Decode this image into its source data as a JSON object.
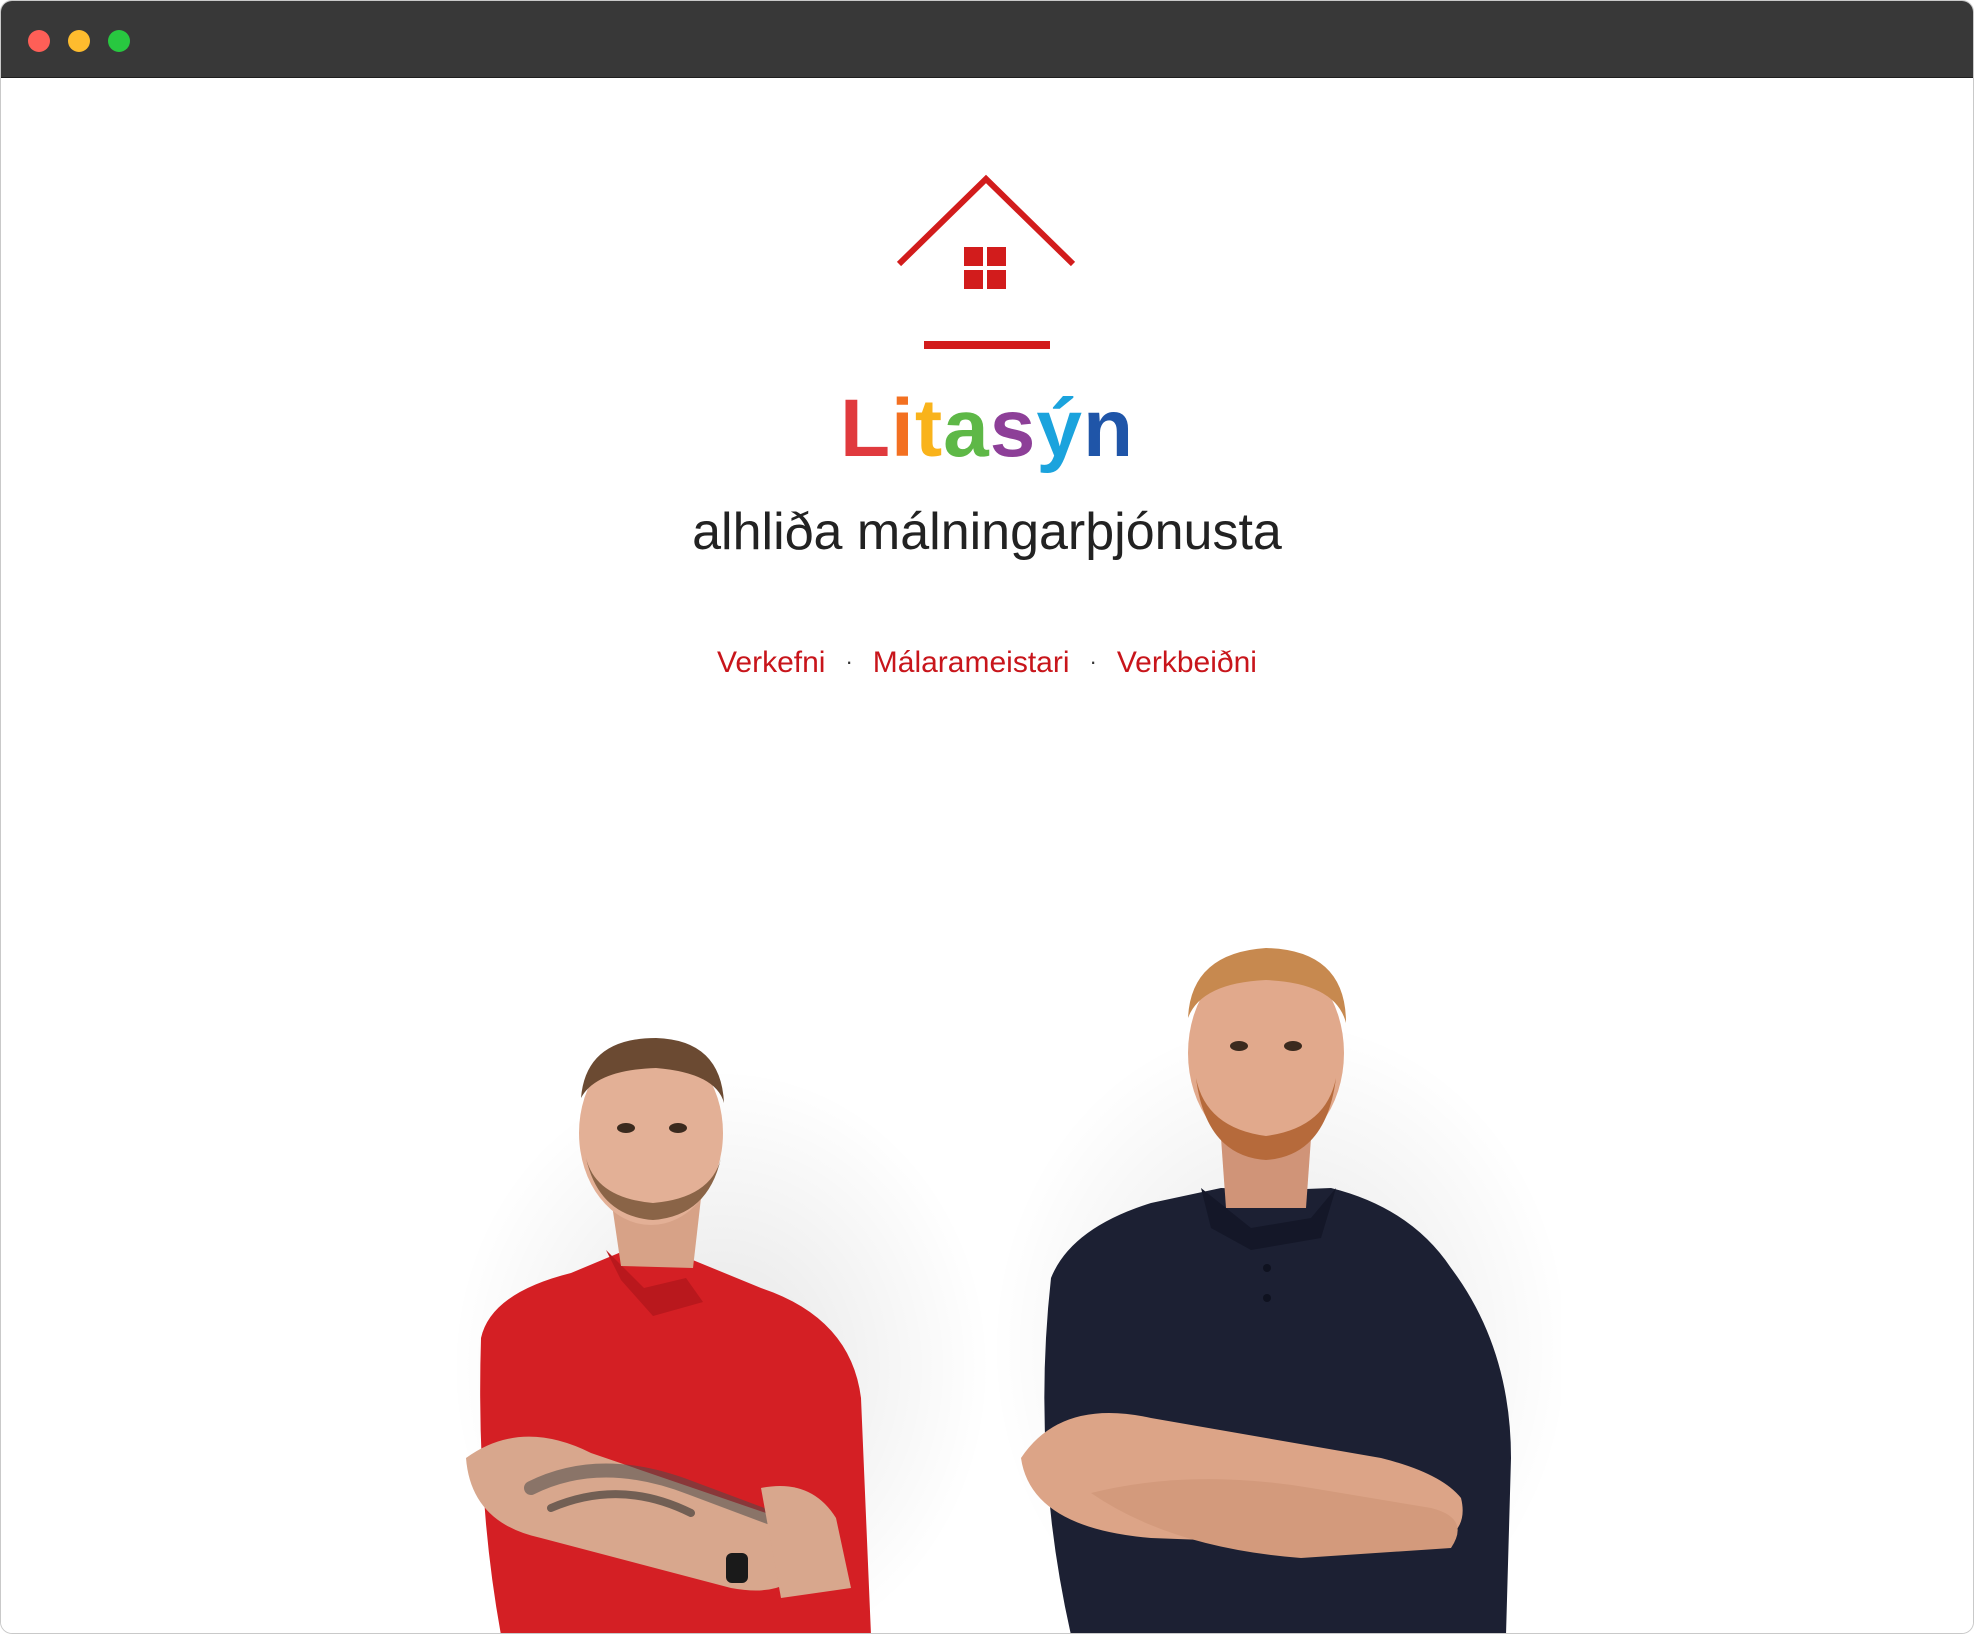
{
  "window": {
    "controls": [
      "close",
      "minimize",
      "maximize"
    ]
  },
  "brand": {
    "logo_icon": "house-icon",
    "letters": [
      {
        "char": "L",
        "color": "#e03a3e"
      },
      {
        "char": "i",
        "color": "#f37021"
      },
      {
        "char": "t",
        "color": "#f9b31b"
      },
      {
        "char": "a",
        "color": "#5eb847"
      },
      {
        "char": "s",
        "color": "#8d3f98"
      },
      {
        "char": "ý",
        "color": "#1ba3dd"
      },
      {
        "char": "n",
        "color": "#1f55a8"
      }
    ],
    "accent_color": "#d21c1c"
  },
  "tagline": "alhliða málningarþjónusta",
  "nav": {
    "items": [
      {
        "label": "Verkefni"
      },
      {
        "label": "Málarameistari"
      },
      {
        "label": "Verkbeiðni"
      }
    ],
    "separator": "·",
    "link_color": "#c8151b"
  },
  "hero": {
    "image_icon": "team-photo",
    "shirt_colors": [
      "#d41f24",
      "#1c2033"
    ]
  }
}
